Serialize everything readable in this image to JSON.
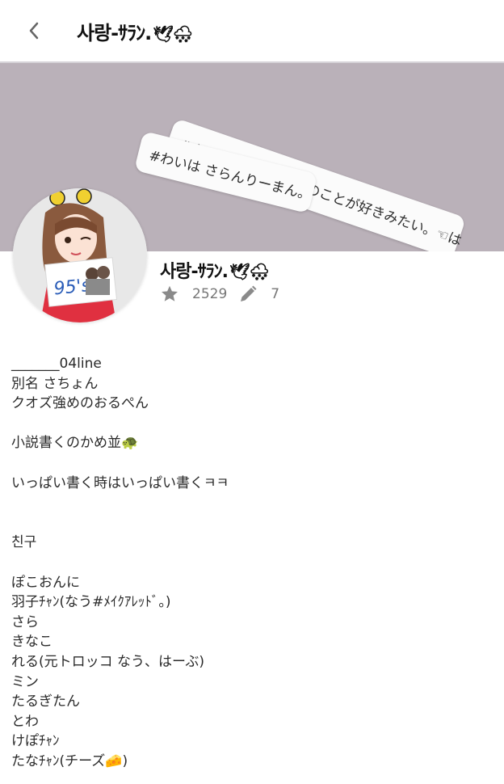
{
  "header": {
    "title": "사랑-ｻﾗﾝ.",
    "title_emoji": "🕊🌨"
  },
  "banner": {
    "tag_1": "#さらんちゃんはわいのことが好きみたい。☜は",
    "tag_2": "#わいは さらんりーまん。"
  },
  "profile": {
    "name": "사랑-ｻﾗﾝ.",
    "name_emoji": "🕊🌨",
    "reputation_icon": "star-icon",
    "reputation": "2529",
    "posts_icon": "pencil-icon",
    "posts": "7",
    "avatar_tag": "95's"
  },
  "bio": [
    "_______04line",
    "別名 さちょん",
    "クオズ強めのおるぺん",
    "",
    "小説書くのかめ並🐢",
    "",
    "いっぱい書く時はいっぱい書くㅋㅋ",
    "",
    "",
    "친구",
    "",
    "ぽこおんに",
    "羽子ﾁｬﾝ(なう#ﾒｲｸｱﾚｯﾄﾞ。)",
    "さら",
    "きなこ",
    "れる(元トロッコ なう、はーぶ)",
    "ミン",
    "たるぎたん",
    "とわ",
    "けぽﾁｬﾝ",
    "たなﾁｬﾝ(チーズ🧀)"
  ],
  "colors": {
    "banner": "#bab1b9",
    "header_border": "#d6d3d8",
    "icon_gray": "#777777"
  }
}
